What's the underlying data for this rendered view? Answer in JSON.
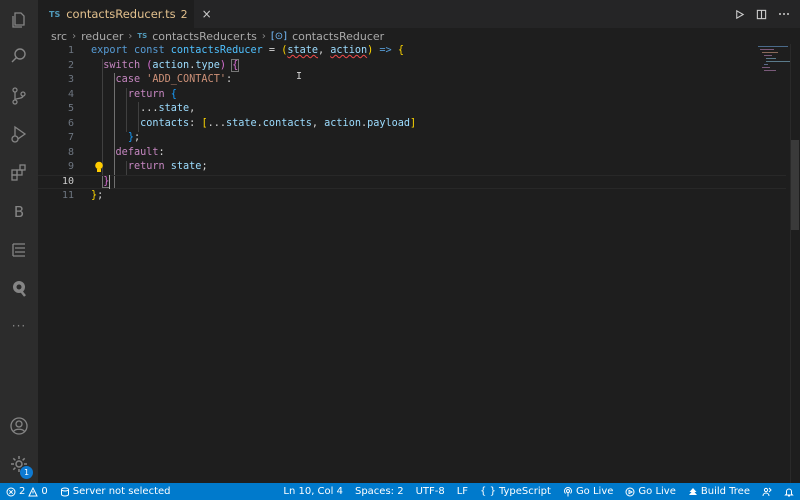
{
  "tab": {
    "lang_badge": "TS",
    "filename": "contactsReducer.ts",
    "problem_count": "2",
    "close_glyph": "×"
  },
  "breadcrumb": {
    "folder1": "src",
    "folder2": "reducer",
    "file_badge": "TS",
    "file": "contactsReducer.ts",
    "symbol_badge": "[⊙]",
    "symbol": "contactsReducer"
  },
  "editor": {
    "line_numbers": [
      "1",
      "2",
      "3",
      "4",
      "5",
      "6",
      "7",
      "8",
      "9",
      "10",
      "11"
    ],
    "current_line": "10",
    "cursor_glyph": "I"
  },
  "activity_bar": {
    "items": [
      "explorer-icon",
      "search-icon",
      "source-control-icon",
      "run-debug-icon",
      "extensions-icon",
      "bootstrap-icon",
      "list-icon",
      "quokka-icon",
      "more-icon"
    ],
    "bootstrap_letter": "B",
    "more_glyph": "···",
    "settings_badge": "1"
  },
  "status_bar": {
    "errors": "2",
    "warnings": "0",
    "server": "Server not selected",
    "position": "Ln 10, Col 4",
    "spaces": "Spaces: 2",
    "encoding": "UTF-8",
    "eol": "LF",
    "braces": "{ }",
    "language": "TypeScript",
    "go_live_1": "Go Live",
    "go_live_2": "Go Live",
    "build_tree": "Build Tree"
  },
  "colors": {
    "status_bar": "#007acc",
    "editor_bg": "#1e1e1e",
    "activity_bg": "#2c2c2c",
    "tab_modified": "#e2c08d"
  }
}
